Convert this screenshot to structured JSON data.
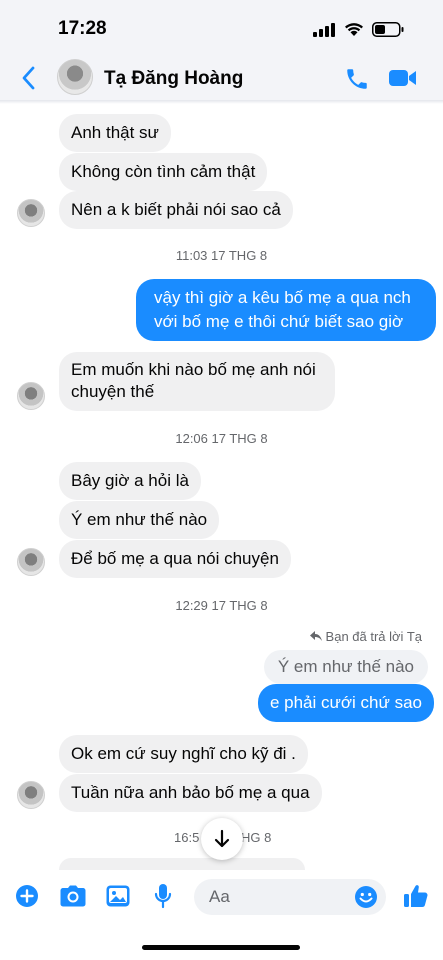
{
  "status_bar": {
    "time": "17:28"
  },
  "header": {
    "contact_name": "Tạ Đăng Hoàng"
  },
  "colors": {
    "accent": "#1a8cff",
    "incoming_bubble": "#f0f0f1",
    "muted_text": "#65676b"
  },
  "messages": [
    {
      "text": "Anh thật sư"
    },
    {
      "text": "Không còn tình cảm thật"
    },
    {
      "text": "Nên a k biết phải nói sao cả"
    },
    {
      "text": "11:03 17 THG 8"
    },
    {
      "text": "vậy thì giờ a kêu bố mẹ a qua nch"
    },
    {
      "text": "với bố mẹ e thôi chứ biết sao giờ"
    },
    {
      "text": "Em muốn khi nào bố mẹ anh nói"
    },
    {
      "text": "chuyện thế"
    },
    {
      "text": "12:06 17 THG 8"
    },
    {
      "text": "Bây giờ a hỏi là"
    },
    {
      "text": "Ý em như thế nào"
    },
    {
      "text": "Để bố mẹ a qua nói chuyện"
    },
    {
      "text": "12:29 17 THG 8"
    },
    {
      "text": "Bạn đã trả lời Tạ"
    },
    {
      "text": "Ý em như thế nào"
    },
    {
      "text": "e phải cưới chứ sao"
    },
    {
      "text": "Ok em cứ suy nghĩ cho kỹ đi ."
    },
    {
      "text": "Tuần nữa anh bảo bố mẹ a qua"
    },
    {
      "text": "16:5"
    },
    {
      "text": "HG 8"
    }
  ],
  "composer": {
    "placeholder": "Aa"
  }
}
